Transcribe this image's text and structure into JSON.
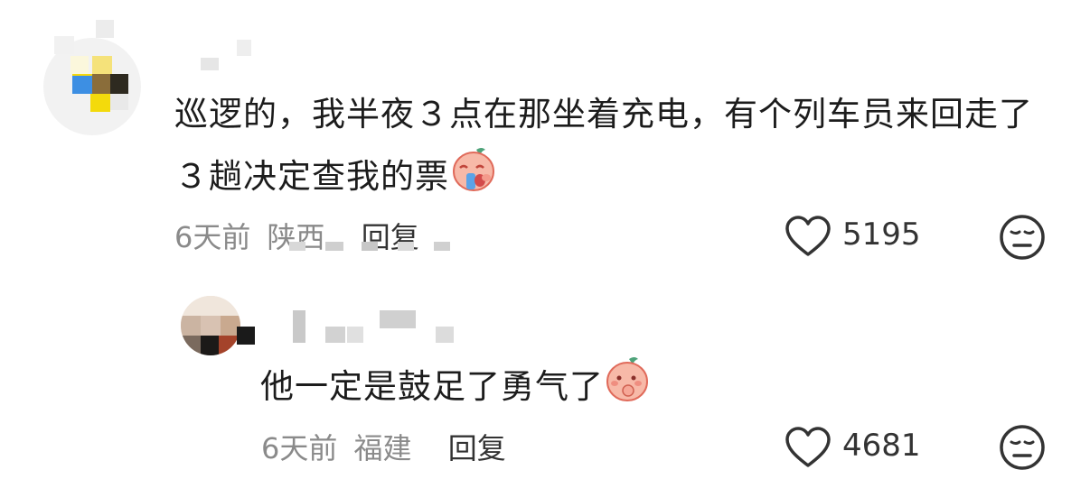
{
  "comments": [
    {
      "text": "巡逻的，我半夜３点在那坐着充电，有个列车员来回走了３趟决定查我的票",
      "time": "6天前",
      "location": "陕西",
      "reply_label": "回复",
      "likes": "5195",
      "sticker": "crying-peach-sticker",
      "reaction": "meh-face-icon"
    },
    {
      "text": "他一定是鼓足了勇气了",
      "time": "6天前",
      "location": "福建",
      "reply_label": "回复",
      "likes": "4681",
      "sticker": "shy-peach-sticker",
      "reaction": "meh-face-icon"
    }
  ]
}
